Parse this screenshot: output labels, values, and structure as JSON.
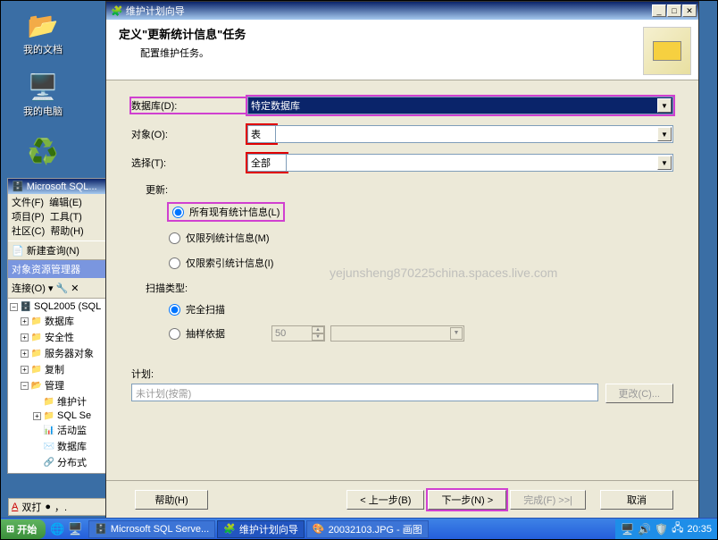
{
  "desktop": {
    "icons": [
      {
        "label": "我的文档",
        "emoji": "📁"
      },
      {
        "label": "我的电脑",
        "emoji": "🖥️"
      },
      {
        "label": "",
        "emoji": "♻️"
      }
    ]
  },
  "sql": {
    "title": "Microsoft SQL...",
    "menus": [
      [
        "文件(F)",
        "编辑(E)"
      ],
      [
        "项目(P)",
        "工具(T)"
      ],
      [
        "社区(C)",
        "帮助(H)"
      ]
    ],
    "new_query": "新建查询(N)",
    "panel": "对象资源管理器",
    "connect": "连接(O) ▾",
    "tree": {
      "root": "SQL2005 (SQL",
      "nodes": [
        "数据库",
        "安全性",
        "服务器对象",
        "复制"
      ],
      "mgmt": "管理",
      "mgmt_children": [
        "维护计",
        "SQL Se",
        "活动监",
        "数据库",
        "分布式"
      ]
    }
  },
  "bottom_bar": {
    "ab": "A",
    "bold": "双打",
    "dot": "●"
  },
  "wizard": {
    "title": "维护计划向导",
    "header_title": "定义\"更新统计信息\"任务",
    "header_sub": "配置维护任务。",
    "labels": {
      "database": "数据库(D):",
      "object": "对象(O):",
      "selection": "选择(T):",
      "update": "更新:",
      "scan_type": "扫描类型:",
      "plan": "计划:"
    },
    "values": {
      "database": "特定数据库",
      "object": "表",
      "selection": "全部"
    },
    "radios": {
      "all_stats": "所有现有统计信息(L)",
      "col_only": "仅限列统计信息(M)",
      "idx_only": "仅限索引统计信息(I)",
      "full_scan": "完全扫描",
      "sample": "抽样依据"
    },
    "sample_val": "50",
    "plan_placeholder": "未计划(按需)",
    "buttons": {
      "change": "更改(C)...",
      "help": "帮助(H)",
      "back": "< 上一步(B)",
      "next": "下一步(N) >",
      "finish": "完成(F) >>|",
      "cancel": "取消"
    }
  },
  "watermark": "yejunsheng870225china.spaces.live.com",
  "taskbar": {
    "start": "开始",
    "tasks": [
      {
        "label": "Microsoft SQL Serve...",
        "icon": "🗄️"
      },
      {
        "label": "维护计划向导",
        "icon": "🧩"
      },
      {
        "label": "20032103.JPG - 画图",
        "icon": "🎨"
      }
    ],
    "clock": "20:35"
  }
}
